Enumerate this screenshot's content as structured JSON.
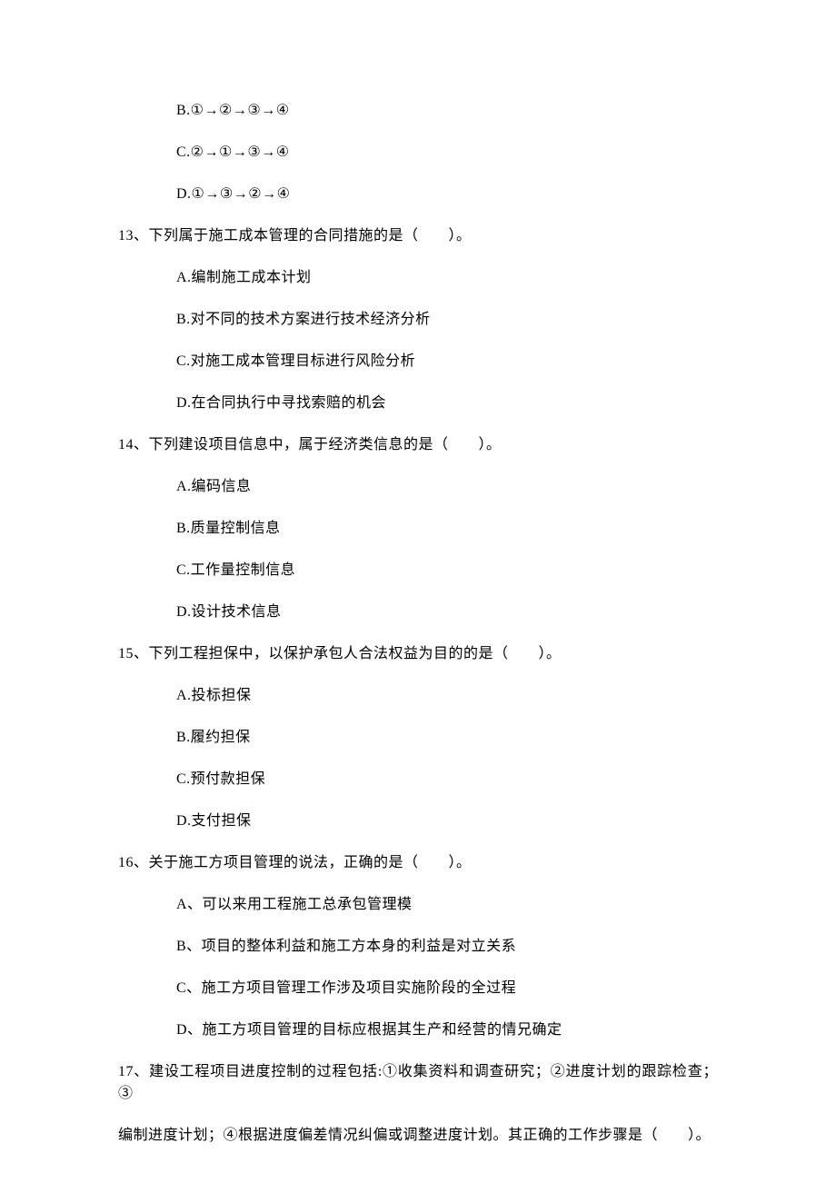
{
  "leading_options": [
    "B.①→②→③→④",
    "C.②→①→③→④",
    "D.①→③→②→④"
  ],
  "questions": [
    {
      "stem": "13、下列属于施工成本管理的合同措施的是（　　）。",
      "options": [
        "A.编制施工成本计划",
        "B.对不同的技术方案进行技术经济分析",
        "C.对施工成本管理目标进行风险分析",
        "D.在合同执行中寻找索赔的机会"
      ]
    },
    {
      "stem": "14、下列建设项目信息中，属于经济类信息的是（　　）。",
      "options": [
        "A.编码信息",
        "B.质量控制信息",
        "C.工作量控制信息",
        "D.设计技术信息"
      ]
    },
    {
      "stem": "15、下列工程担保中，以保护承包人合法权益为目的的是（　　）。",
      "options": [
        "A.投标担保",
        "B.履约担保",
        "C.预付款担保",
        "D.支付担保"
      ]
    },
    {
      "stem": "16、关于施工方项目管理的说法，正确的是（　　）。",
      "options": [
        "A、可以来用工程施工总承包管理模",
        "B、项目的整体利益和施工方本身的利益是对立关系",
        "C、施工方项目管理工作涉及项目实施阶段的全过程",
        "D、施工方项目管理的目标应根据其生产和经营的情兄确定"
      ]
    },
    {
      "stem_lines": [
        "17、建设工程项目进度控制的过程包括:①收集资料和调查研究；②进度计划的跟踪检查；③",
        "编制进度计划；④根据进度偏差情况纠偏或调整进度计划。其正确的工作步骤是（　　）。"
      ]
    }
  ]
}
